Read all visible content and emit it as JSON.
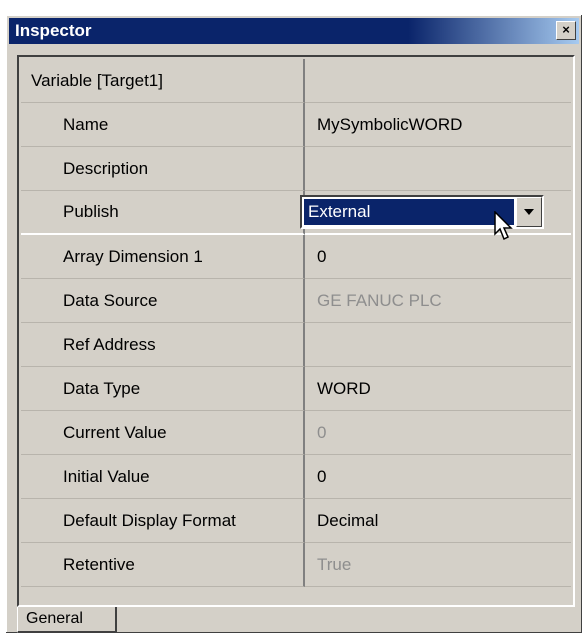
{
  "window": {
    "title": "Inspector",
    "close_label": "×"
  },
  "rows": [
    {
      "name": "Variable [Target1]",
      "value": ""
    },
    {
      "name": "Name",
      "value": "MySymbolicWORD"
    },
    {
      "name": "Description",
      "value": ""
    },
    {
      "name": "Publish",
      "value": "External"
    },
    {
      "name": "Array Dimension 1",
      "value": "0"
    },
    {
      "name": "Data Source",
      "value": "GE FANUC PLC"
    },
    {
      "name": "Ref Address",
      "value": ""
    },
    {
      "name": "Data Type",
      "value": "WORD"
    },
    {
      "name": "Current Value",
      "value": "0"
    },
    {
      "name": "Initial Value",
      "value": "0"
    },
    {
      "name": "Default Display Format",
      "value": "Decimal"
    },
    {
      "name": "Retentive",
      "value": "True"
    }
  ],
  "tabs": [
    {
      "label": "General"
    }
  ],
  "colors": {
    "selection": "#0a246a",
    "disabled_text": "#8e8e8e",
    "face": "#d4d0c8"
  }
}
